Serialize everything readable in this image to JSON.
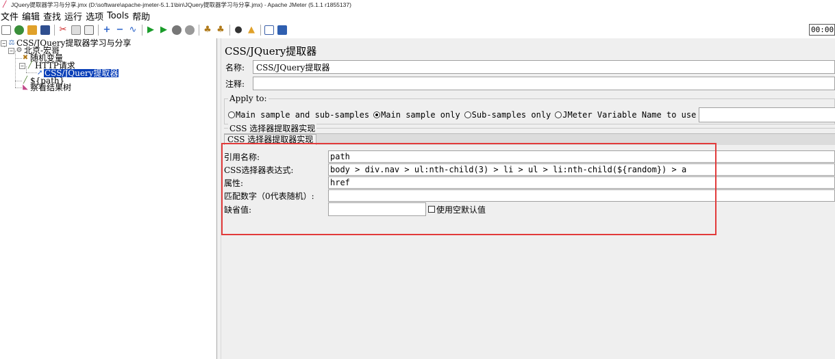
{
  "window": {
    "title": "JQuery提取器学习与分享.jmx (D:\\software\\apache-jmeter-5.1.1\\bin\\JQuery提取器学习与分享.jmx) - Apache JMeter (5.1.1 r1855137)"
  },
  "menu": [
    "文件",
    "编辑",
    "查找",
    "运行",
    "选项",
    "Tools",
    "帮助"
  ],
  "toolbar": {
    "timer": "00:00",
    "icons": [
      "new-icon",
      "templates-icon",
      "open-icon",
      "save-icon",
      "cut-icon",
      "copy-icon",
      "paste-icon",
      "expand-icon",
      "collapse-icon",
      "toggle-icon",
      "start-icon",
      "start-no-pause-icon",
      "stop-icon",
      "shutdown-icon",
      "clear-icon",
      "clear-all-icon",
      "search-icon",
      "reset-search-icon",
      "function-helper-icon",
      "help-icon"
    ]
  },
  "tree": {
    "nodes": [
      {
        "label": "CSS/JQuery提取器学习与分享",
        "icon": "test-plan-icon"
      },
      {
        "label": "北京-宏哥",
        "icon": "thread-group-icon"
      },
      {
        "label": "随机变量",
        "icon": "random-variable-icon"
      },
      {
        "label": "HTTP请求",
        "icon": "http-sampler-icon"
      },
      {
        "label": "CSS/JQuery提取器",
        "icon": "extractor-icon",
        "selected": true
      },
      {
        "label": "${path}",
        "icon": "sampler-icon"
      },
      {
        "label": "察看结果树",
        "icon": "listener-icon"
      }
    ]
  },
  "panel": {
    "title": "CSS/JQuery提取器",
    "name_label": "名称:",
    "name_value": "CSS/JQuery提取器",
    "comment_label": "注释:",
    "comment_value": "",
    "apply_to": {
      "legend": "Apply to:",
      "options": [
        {
          "label": "Main sample and sub-samples",
          "selected": false
        },
        {
          "label": "Main sample only",
          "selected": true
        },
        {
          "label": "Sub-samples only",
          "selected": false
        },
        {
          "label": "JMeter Variable Name to use",
          "selected": false
        }
      ],
      "variable_value": ""
    },
    "impl": {
      "legend": "CSS 选择器提取器实现",
      "tab_label": "CSS 选择器提取器实现"
    },
    "form": {
      "ref_name_label": "引用名称:",
      "ref_name_value": "path",
      "css_expr_label": "CSS选择器表达式:",
      "css_expr_value": "body > div.nav > ul:nth-child(3) > li > ul > li:nth-child(${random}) > a",
      "attr_label": "属性:",
      "attr_value": "href",
      "match_no_label": "匹配数字（0代表随机）:",
      "match_no_value": "",
      "default_label": "缺省值:",
      "default_value": "",
      "use_empty_label": "使用空默认值"
    }
  },
  "colors": {
    "selection": "#0a3fb8",
    "highlight_box": "#e23a3a",
    "panel_bg": "#efefef"
  }
}
